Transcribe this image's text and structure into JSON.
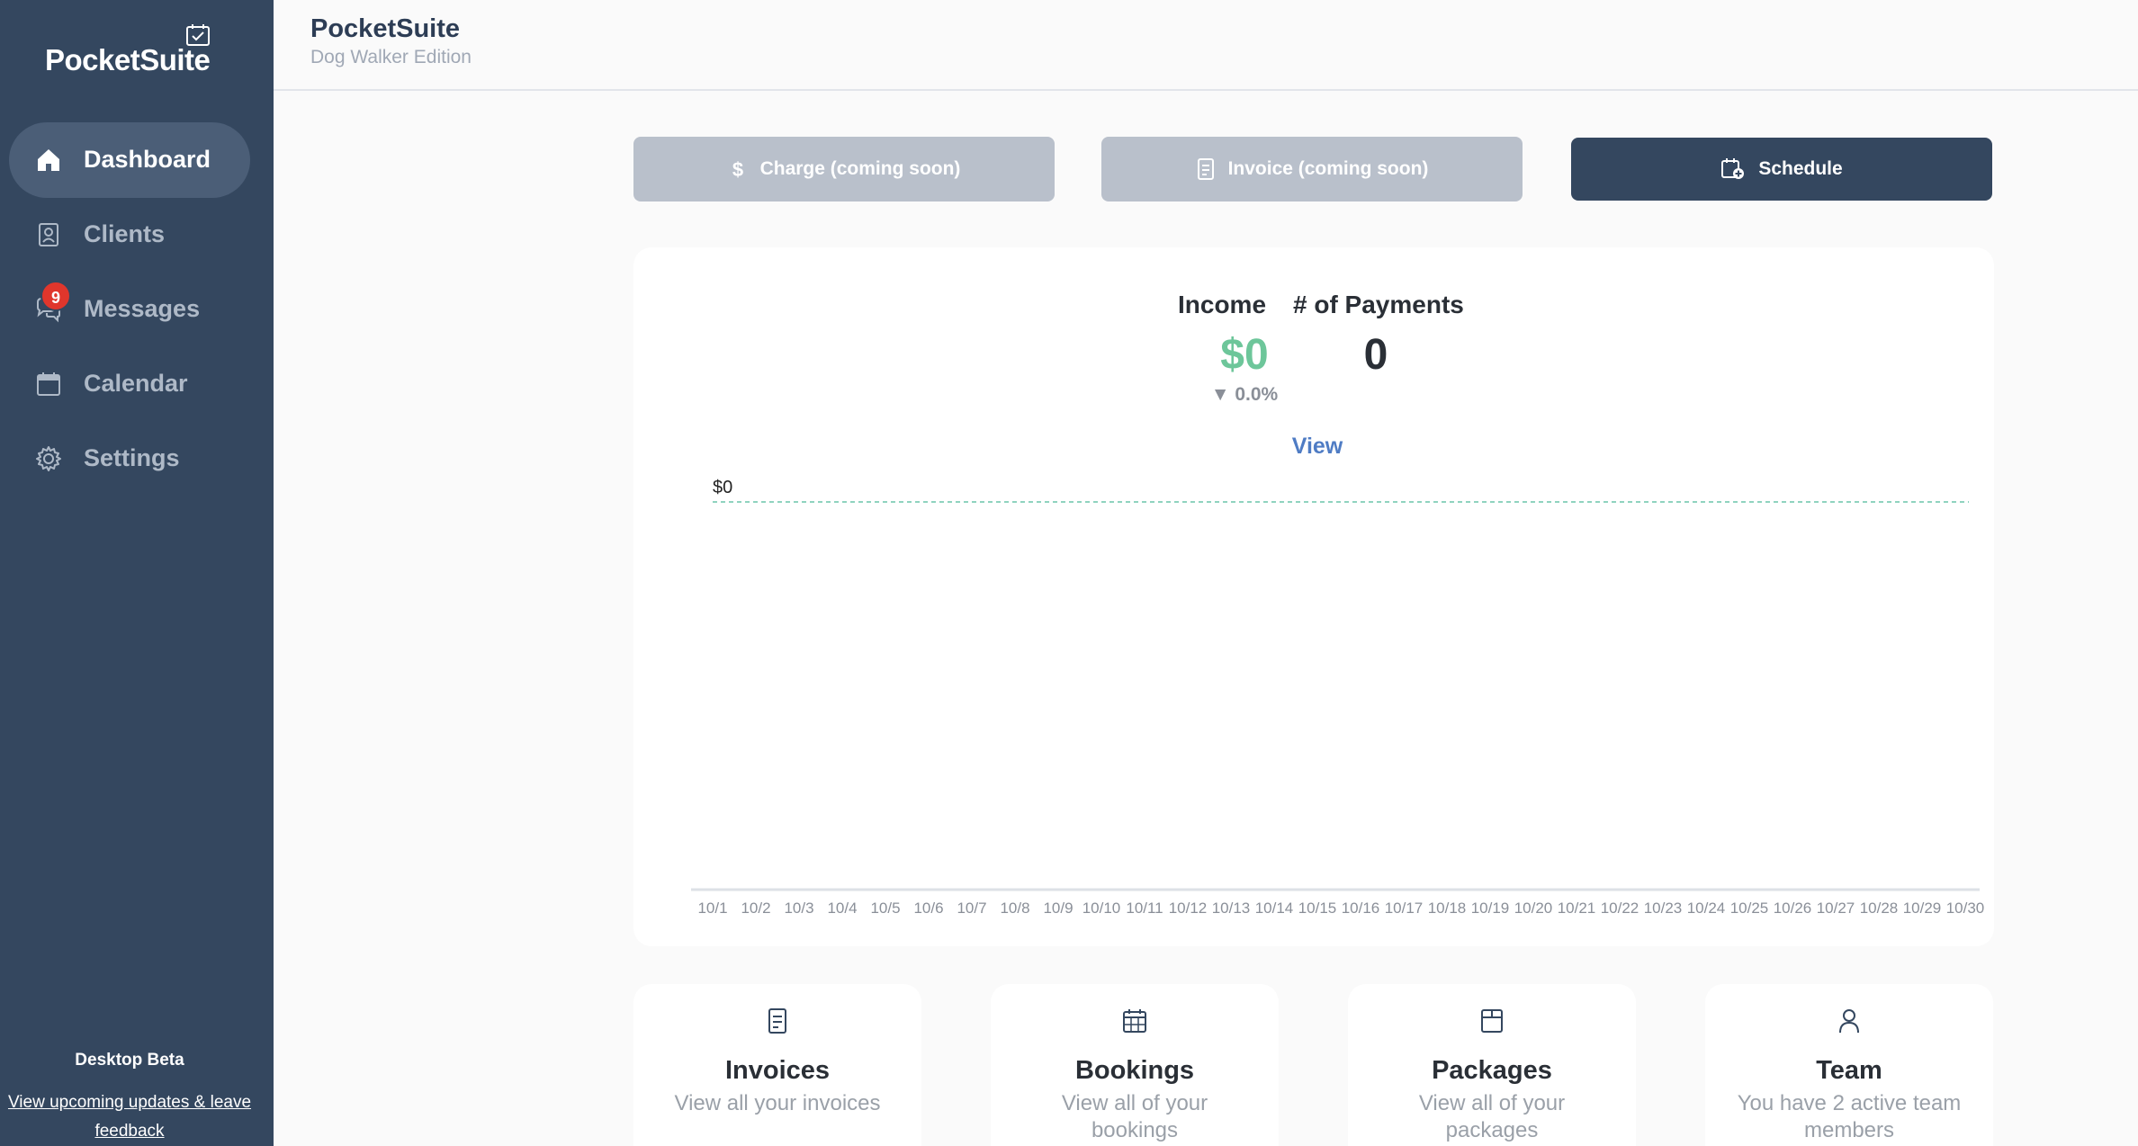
{
  "sidebar": {
    "logo": "PocketSuite",
    "items": [
      {
        "label": "Dashboard",
        "icon": "home-icon"
      },
      {
        "label": "Clients",
        "icon": "contact-card-icon"
      },
      {
        "label": "Messages",
        "icon": "chat-bubbles-icon",
        "badge": "9"
      },
      {
        "label": "Calendar",
        "icon": "calendar-icon"
      },
      {
        "label": "Settings",
        "icon": "gear-icon"
      }
    ],
    "beta_title": "Desktop Beta",
    "beta_link": "View upcoming updates & leave feedback"
  },
  "header": {
    "brand": "PocketSuite",
    "edition": "Dog Walker Edition"
  },
  "actions": {
    "charge": "Charge (coming soon)",
    "invoice": "Invoice (coming soon)",
    "schedule": "Schedule"
  },
  "stats": {
    "income_label": "Income",
    "income_value": "$0",
    "income_change": "▼ 0.0%",
    "payments_label": "# of Payments",
    "payments_value": "0",
    "view_label": "View"
  },
  "chart_data": {
    "type": "line",
    "x": [
      "10/1",
      "10/2",
      "10/3",
      "10/4",
      "10/5",
      "10/6",
      "10/7",
      "10/8",
      "10/9",
      "10/10",
      "10/11",
      "10/12",
      "10/13",
      "10/14",
      "10/15",
      "10/16",
      "10/17",
      "10/18",
      "10/19",
      "10/20",
      "10/21",
      "10/22",
      "10/23",
      "10/24",
      "10/25",
      "10/26",
      "10/27",
      "10/28",
      "10/29",
      "10/30"
    ],
    "series": [
      {
        "values": [
          0,
          0,
          0,
          0,
          0,
          0,
          0,
          0,
          0,
          0,
          0,
          0,
          0,
          0,
          0,
          0,
          0,
          0,
          0,
          0,
          0,
          0,
          0,
          0,
          0,
          0,
          0,
          0,
          0,
          0
        ]
      }
    ],
    "y_tick_labels": [
      "$0"
    ],
    "line_color": "#8fd3bf",
    "grid": false
  },
  "tiles": [
    {
      "title": "Invoices",
      "subtitle": "View all your invoices",
      "icon": "invoice-icon"
    },
    {
      "title": "Bookings",
      "subtitle": "View all of your bookings",
      "icon": "bookings-calendar-icon"
    },
    {
      "title": "Packages",
      "subtitle": "View all of your packages",
      "icon": "package-box-icon"
    },
    {
      "title": "Team",
      "subtitle": "You have 2 active team members",
      "icon": "person-icon"
    }
  ],
  "colors": {
    "sidebar": "#34475f",
    "primary": "#34475f",
    "income": "#6dc69a",
    "link": "#4f7cc4",
    "badge": "#e0362c"
  }
}
